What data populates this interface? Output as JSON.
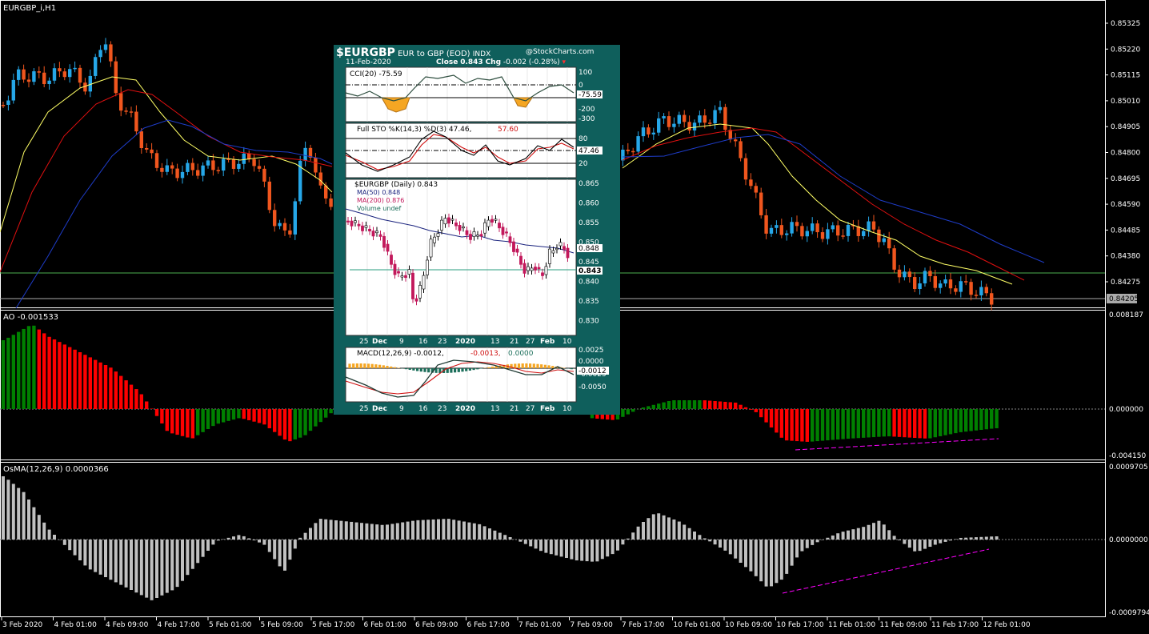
{
  "terminal": {
    "main_label": "EURGBP_i,H1",
    "ao_label": "AO -0.001533",
    "osma_label": "OsMA(12,26,9) 0.0000366",
    "price_ticks": [
      "0.85325",
      "0.85220",
      "0.85115",
      "0.85010",
      "0.84905",
      "0.84800",
      "0.84695",
      "0.84590",
      "0.84485",
      "0.84380",
      "0.84275"
    ],
    "current_price": "0.84205",
    "ao_ticks": [
      "0.008187",
      "0.000000",
      "-0.004150"
    ],
    "osma_ticks": [
      "0.0009705",
      "0.0000000",
      "-0.0009794"
    ],
    "time_ticks": [
      "3 Feb 2020",
      "4 Feb 01:00",
      "4 Feb 09:00",
      "4 Feb 17:00",
      "5 Feb 01:00",
      "5 Feb 09:00",
      "5 Feb 17:00",
      "6 Feb 01:00",
      "6 Feb 09:00",
      "6 Feb 17:00",
      "7 Feb 01:00",
      "7 Feb 09:00",
      "7 Feb 17:00",
      "10 Feb 01:00",
      "10 Feb 09:00",
      "10 Feb 17:00",
      "11 Feb 01:00",
      "11 Feb 09:00",
      "11 Feb 17:00",
      "12 Feb 01:00"
    ],
    "colors": {
      "up": "#26a7e8",
      "down": "#f0561e",
      "ao_up": "#008000",
      "ao_down": "#ff0000",
      "osma": "#c0c0c0",
      "ma_fast": "#ffff66",
      "ma_mid": "#e01010",
      "ma_slow": "#1e3cc8",
      "divergence": "#ff00ff"
    }
  },
  "stockcharts": {
    "symbol": "$EURGBP",
    "name": "EUR to GBP (EOD)",
    "exchange": "INDX",
    "brand": "@StockCharts.com",
    "date": "11-Feb-2020",
    "close_label": "Close",
    "close_value": "0.843",
    "chg_label": "Chg",
    "chg_value": "-0.002 (-0.28%)",
    "cci_label": "CCI(20) -75.59",
    "cci_value": "-75.59",
    "cci_ticks": [
      "100",
      "0",
      "-200",
      "-300"
    ],
    "sto_label": "Full STO %K(14,3) %D(3) 47.46,",
    "sto_d": "57.60",
    "sto_value": "47.46",
    "sto_ticks": [
      "80",
      "20"
    ],
    "price_label": "$EURGBP (Daily) 0.843",
    "ma50_label": "MA(50) 0.848",
    "ma200_label": "MA(200) 0.876",
    "vol_label": "Volume undef",
    "price_ticks": [
      "0.865",
      "0.860",
      "0.855",
      "0.850",
      "0.845",
      "0.840",
      "0.835",
      "0.830"
    ],
    "ma50_value": "0.848",
    "price_value": "0.843",
    "dates": [
      "25",
      "Dec",
      "9",
      "16",
      "23",
      "2020",
      "13",
      "21",
      "27",
      "Feb",
      "10"
    ],
    "macd_label": "MACD(12,26,9) -0.0012,",
    "macd_signal": "-0.0013,",
    "macd_hist": "0.0000",
    "macd_ticks": [
      "0.0025",
      "0.0000",
      "-0.0025",
      "-0.0050"
    ],
    "macd_value": "-0.0012"
  }
}
